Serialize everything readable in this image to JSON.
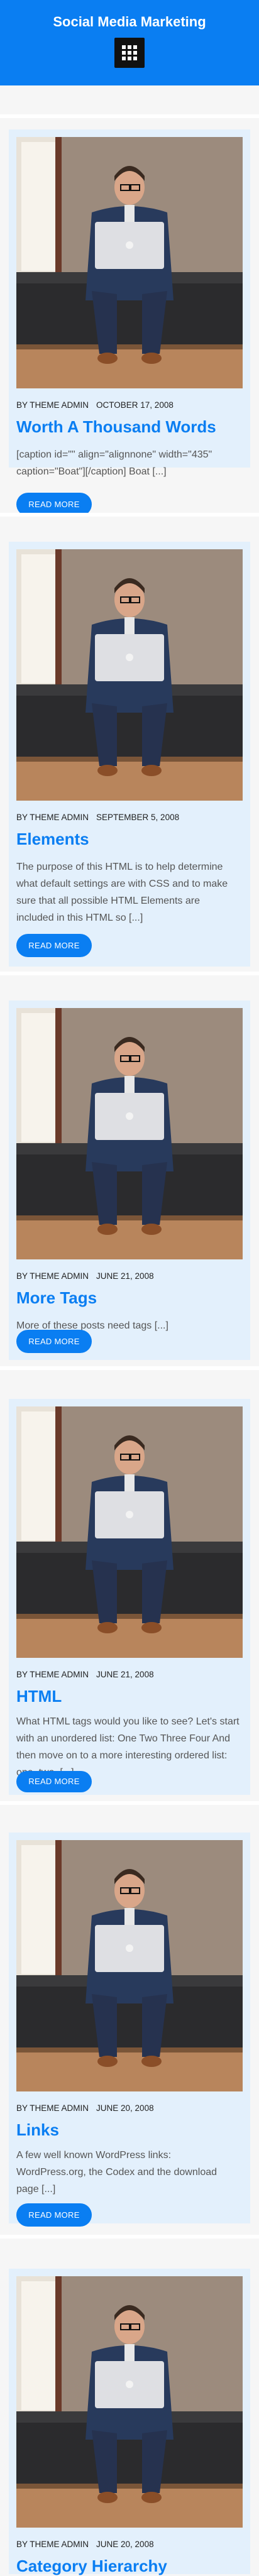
{
  "site": {
    "title": "Social Media Marketing",
    "menu_icon": "grid-icon"
  },
  "posts": [
    {
      "author": "BY THEME ADMIN",
      "date": "OCTOBER 17, 2008",
      "title": "Worth A Thousand Words",
      "excerpt": "[caption id=\"\" align=\"alignnone\" width=\"435\" caption=\"Boat\"][/caption] Boat [...]",
      "read_more": "READ MORE",
      "image": "man-with-laptop-on-sofa"
    },
    {
      "author": "BY THEME ADMIN",
      "date": "SEPTEMBER 5, 2008",
      "title": "Elements",
      "excerpt": "The purpose of this HTML is to help determine what default settings are with CSS and to make sure that all possible HTML Elements are included in this HTML so [...]",
      "read_more": "READ MORE",
      "image": "man-with-laptop-on-sofa"
    },
    {
      "author": "BY THEME ADMIN",
      "date": "JUNE 21, 2008",
      "title": "More Tags",
      "excerpt": "More of these posts need tags [...]",
      "read_more": "READ MORE",
      "image": "man-with-laptop-on-sofa"
    },
    {
      "author": "BY THEME ADMIN",
      "date": "JUNE 21, 2008",
      "title": "HTML",
      "excerpt": "What HTML tags would you like to see? Let's start with an unordered list: One Two Three Four And then move on to a more interesting ordered list: one, two, [...]",
      "read_more": "READ MORE",
      "image": "man-with-laptop-on-sofa"
    },
    {
      "author": "BY THEME ADMIN",
      "date": "JUNE 20, 2008",
      "title": "Links",
      "excerpt": "A few well known WordPress links: WordPress.org, the Codex and the download page [...]",
      "read_more": "READ MORE",
      "image": "man-with-laptop-on-sofa"
    },
    {
      "author": "BY THEME ADMIN",
      "date": "JUNE 20, 2008",
      "title": "Category Hierarchy",
      "excerpt": "",
      "read_more": "",
      "image": "man-with-laptop-on-sofa"
    }
  ]
}
